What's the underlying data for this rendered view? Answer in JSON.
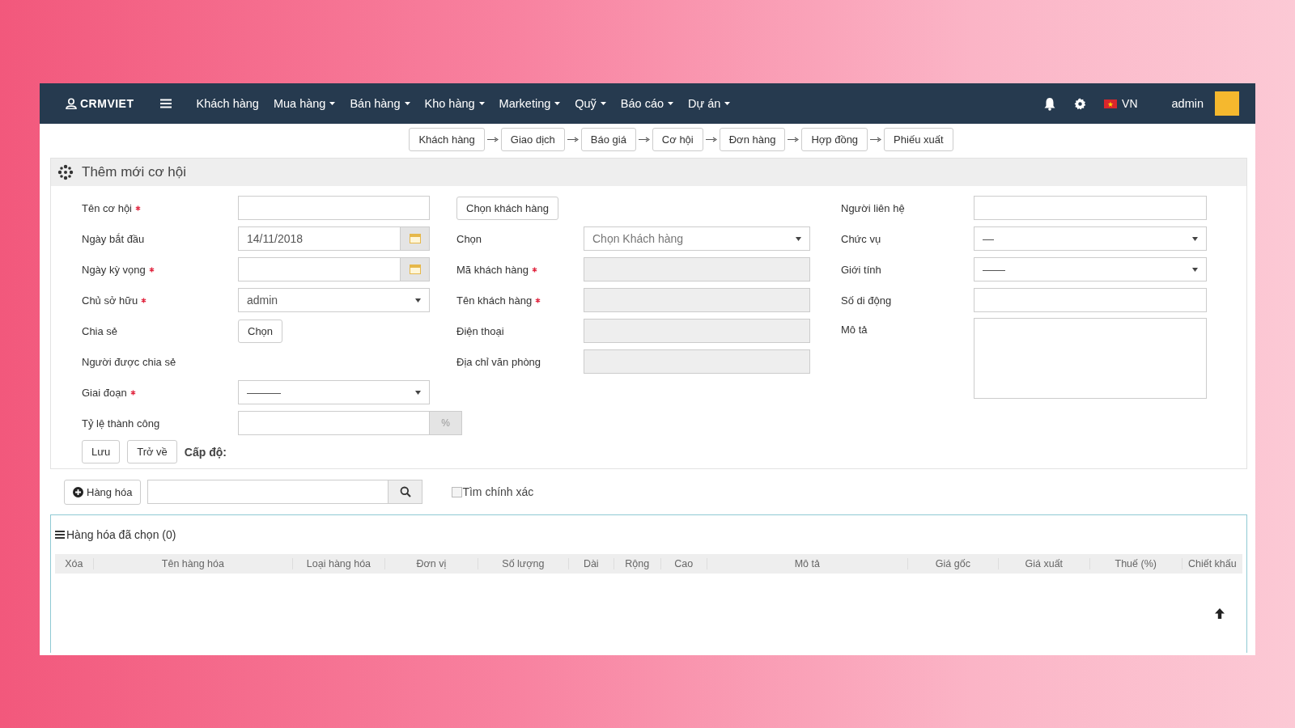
{
  "navbar": {
    "logo": "CRMVIET",
    "menu": [
      {
        "label": "Khách hàng",
        "dropdown": false
      },
      {
        "label": "Mua hàng",
        "dropdown": true
      },
      {
        "label": "Bán hàng",
        "dropdown": true
      },
      {
        "label": "Kho hàng",
        "dropdown": true
      },
      {
        "label": "Marketing",
        "dropdown": true
      },
      {
        "label": "Quỹ",
        "dropdown": true
      },
      {
        "label": "Báo cáo",
        "dropdown": true
      },
      {
        "label": "Dự án",
        "dropdown": true
      }
    ],
    "language": "VN",
    "user": "admin"
  },
  "steps": [
    "Khách hàng",
    "Giao dịch",
    "Báo giá",
    "Cơ hội",
    "Đơn hàng",
    "Hợp đồng",
    "Phiếu xuất"
  ],
  "panel": {
    "title": "Thêm mới cơ hội",
    "left_fields": [
      {
        "label": "Tên cơ hội",
        "required": true,
        "kind": "textarea"
      },
      {
        "label": "Ngày bắt đầu",
        "required": false,
        "kind": "date",
        "value": "14/11/2018"
      },
      {
        "label": "Ngày kỳ vọng",
        "required": true,
        "kind": "date"
      },
      {
        "label": "Chủ sở hữu",
        "required": true,
        "kind": "select",
        "value": "admin"
      },
      {
        "label": "Chia sẻ",
        "required": false,
        "kind": "button",
        "button": "Chọn"
      },
      {
        "label": "Người được chia sẻ",
        "required": false,
        "kind": "none"
      },
      {
        "label": "Giai đoạn",
        "required": true,
        "kind": "select",
        "value": "———"
      },
      {
        "label": "Tỷ lệ thành công",
        "required": false,
        "kind": "percent",
        "addon": "%"
      }
    ],
    "actions": [
      "Lưu",
      "Trở về"
    ],
    "level_label": "Cấp độ:",
    "customer_button": "Chọn khách hàng",
    "middle_fields": [
      {
        "label": "Chọn",
        "required": false,
        "kind": "select",
        "placeholder": "Chọn Khách hàng"
      },
      {
        "label": "Mã khách hàng",
        "required": true,
        "kind": "textarea",
        "disabled": true
      },
      {
        "label": "Tên khách hàng",
        "required": true,
        "kind": "textarea",
        "disabled": true
      },
      {
        "label": "Điện thoại",
        "required": false,
        "kind": "textarea",
        "disabled": true
      },
      {
        "label": "Địa chỉ văn phòng",
        "required": false,
        "kind": "textarea",
        "disabled": true
      }
    ],
    "right_fields": [
      {
        "label": "Người liên hệ",
        "required": false,
        "kind": "textarea"
      },
      {
        "label": "Chức vụ",
        "required": false,
        "kind": "select",
        "value": "—"
      },
      {
        "label": "Giới tính",
        "required": false,
        "kind": "select",
        "value": "——"
      },
      {
        "label": "Số di động",
        "required": false,
        "kind": "textarea"
      },
      {
        "label": "Mô tả",
        "required": false,
        "kind": "bigtext"
      }
    ]
  },
  "search": {
    "add_button": "Hàng hóa",
    "exact": {
      "label": "Tìm chính xác",
      "checked": false
    }
  },
  "table": {
    "title": "Hàng hóa đã chọn (0)",
    "columns": [
      "Xóa",
      "Tên hàng hóa",
      "Loại hàng hóa",
      "Đơn vị",
      "Số lượng",
      "Dài",
      "Rộng",
      "Cao",
      "Mô tả",
      "Giá gốc",
      "Giá xuất",
      "Thuế (%)",
      "Chiết khấu"
    ]
  }
}
